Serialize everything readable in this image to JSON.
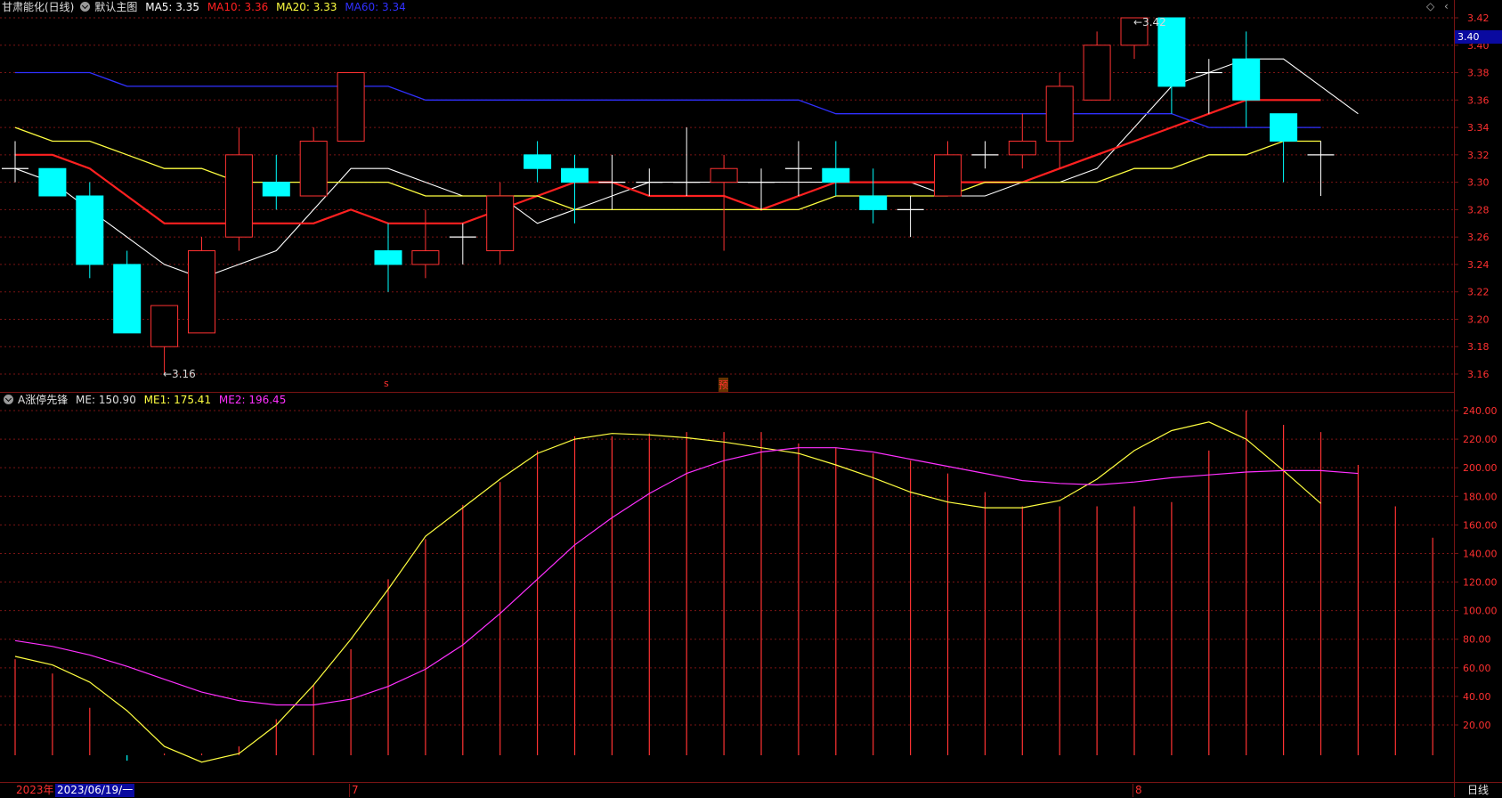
{
  "header": {
    "stock_name": "甘肃能化(日线)",
    "main_chart_label": "默认主图",
    "ma5": "MA5: 3.35",
    "ma10": "MA10: 3.36",
    "ma20": "MA20: 3.33",
    "ma60": "MA60: 3.34"
  },
  "price_axis": {
    "current_price": "3.40",
    "ticks": [
      "3.42",
      "3.40",
      "3.38",
      "3.36",
      "3.34",
      "3.32",
      "3.30",
      "3.28",
      "3.26",
      "3.24",
      "3.22",
      "3.20",
      "3.18",
      "3.16"
    ]
  },
  "indicator": {
    "title": "A涨停先锋",
    "me": "ME: 150.90",
    "me1": "ME1: 175.41",
    "me2": "ME2: 196.45",
    "ticks": [
      "240.00",
      "220.00",
      "200.00",
      "180.00",
      "160.00",
      "140.00",
      "120.00",
      "100.00",
      "80.00",
      "60.00",
      "40.00",
      "20.00"
    ]
  },
  "annotations": {
    "low_label": "←3.16",
    "high_label": "←3.42",
    "marker_s": "s",
    "marker_cn": "预"
  },
  "bottom_bar": {
    "year": "2023年",
    "date": "2023/06/19/一",
    "month_7": "7",
    "month_8": "8",
    "period": "日线"
  },
  "colors": {
    "up": "#ff3232",
    "down": "#00ffff",
    "ma5": "#ffffff",
    "ma10": "#ff2020",
    "ma20": "#ffff40",
    "ma60": "#3030ff",
    "me1": "#ffff40",
    "me2": "#ff30ff",
    "grid": "#7a1414"
  },
  "chart_data": [
    {
      "type": "candlestick",
      "title": "甘肃能化(日线)",
      "ylim": [
        3.15,
        3.43
      ],
      "candles": [
        {
          "o": 3.31,
          "h": 3.33,
          "l": 3.3,
          "c": 3.31
        },
        {
          "o": 3.31,
          "h": 3.31,
          "l": 3.29,
          "c": 3.29
        },
        {
          "o": 3.29,
          "h": 3.3,
          "l": 3.23,
          "c": 3.24
        },
        {
          "o": 3.24,
          "h": 3.25,
          "l": 3.19,
          "c": 3.19
        },
        {
          "o": 3.18,
          "h": 3.21,
          "l": 3.16,
          "c": 3.21
        },
        {
          "o": 3.19,
          "h": 3.26,
          "l": 3.19,
          "c": 3.25
        },
        {
          "o": 3.26,
          "h": 3.34,
          "l": 3.25,
          "c": 3.32
        },
        {
          "o": 3.3,
          "h": 3.32,
          "l": 3.28,
          "c": 3.29
        },
        {
          "o": 3.29,
          "h": 3.34,
          "l": 3.29,
          "c": 3.33
        },
        {
          "o": 3.33,
          "h": 3.38,
          "l": 3.33,
          "c": 3.38
        },
        {
          "o": 3.25,
          "h": 3.27,
          "l": 3.22,
          "c": 3.24
        },
        {
          "o": 3.24,
          "h": 3.28,
          "l": 3.23,
          "c": 3.25
        },
        {
          "o": 3.26,
          "h": 3.27,
          "l": 3.24,
          "c": 3.26
        },
        {
          "o": 3.25,
          "h": 3.3,
          "l": 3.24,
          "c": 3.29
        },
        {
          "o": 3.32,
          "h": 3.33,
          "l": 3.3,
          "c": 3.31
        },
        {
          "o": 3.31,
          "h": 3.32,
          "l": 3.27,
          "c": 3.3
        },
        {
          "o": 3.3,
          "h": 3.32,
          "l": 3.28,
          "c": 3.3
        },
        {
          "o": 3.3,
          "h": 3.31,
          "l": 3.29,
          "c": 3.3
        },
        {
          "o": 3.3,
          "h": 3.34,
          "l": 3.29,
          "c": 3.3
        },
        {
          "o": 3.3,
          "h": 3.32,
          "l": 3.25,
          "c": 3.31
        },
        {
          "o": 3.3,
          "h": 3.31,
          "l": 3.28,
          "c": 3.3
        },
        {
          "o": 3.31,
          "h": 3.33,
          "l": 3.29,
          "c": 3.31
        },
        {
          "o": 3.31,
          "h": 3.33,
          "l": 3.29,
          "c": 3.3
        },
        {
          "o": 3.29,
          "h": 3.31,
          "l": 3.27,
          "c": 3.28
        },
        {
          "o": 3.28,
          "h": 3.29,
          "l": 3.26,
          "c": 3.28
        },
        {
          "o": 3.29,
          "h": 3.33,
          "l": 3.29,
          "c": 3.32
        },
        {
          "o": 3.32,
          "h": 3.33,
          "l": 3.31,
          "c": 3.32
        },
        {
          "o": 3.32,
          "h": 3.35,
          "l": 3.31,
          "c": 3.33
        },
        {
          "o": 3.33,
          "h": 3.38,
          "l": 3.31,
          "c": 3.37
        },
        {
          "o": 3.36,
          "h": 3.41,
          "l": 3.36,
          "c": 3.4
        },
        {
          "o": 3.4,
          "h": 3.42,
          "l": 3.39,
          "c": 3.42
        },
        {
          "o": 3.42,
          "h": 3.42,
          "l": 3.35,
          "c": 3.37
        },
        {
          "o": 3.38,
          "h": 3.39,
          "l": 3.35,
          "c": 3.38
        },
        {
          "o": 3.39,
          "h": 3.41,
          "l": 3.34,
          "c": 3.36
        },
        {
          "o": 3.35,
          "h": 3.35,
          "l": 3.3,
          "c": 3.33
        },
        {
          "o": 3.32,
          "h": 3.33,
          "l": 3.29,
          "c": 3.32
        }
      ],
      "series": [
        {
          "name": "MA5",
          "values": [
            3.31,
            3.3,
            3.28,
            3.26,
            3.24,
            3.23,
            3.24,
            3.25,
            3.28,
            3.31,
            3.31,
            3.3,
            3.29,
            3.29,
            3.27,
            3.28,
            3.29,
            3.3,
            3.3,
            3.3,
            3.3,
            3.3,
            3.3,
            3.3,
            3.3,
            3.29,
            3.29,
            3.3,
            3.3,
            3.31,
            3.34,
            3.37,
            3.38,
            3.39,
            3.39,
            3.37,
            3.35
          ]
        },
        {
          "name": "MA10",
          "values": [
            3.32,
            3.32,
            3.31,
            3.29,
            3.27,
            3.27,
            3.27,
            3.27,
            3.27,
            3.28,
            3.27,
            3.27,
            3.27,
            3.28,
            3.29,
            3.3,
            3.3,
            3.29,
            3.29,
            3.29,
            3.28,
            3.29,
            3.3,
            3.3,
            3.3,
            3.3,
            3.3,
            3.3,
            3.31,
            3.32,
            3.33,
            3.34,
            3.35,
            3.36,
            3.36,
            3.36
          ]
        },
        {
          "name": "MA20",
          "values": [
            3.34,
            3.33,
            3.33,
            3.32,
            3.31,
            3.31,
            3.3,
            3.3,
            3.3,
            3.3,
            3.3,
            3.29,
            3.29,
            3.29,
            3.29,
            3.28,
            3.28,
            3.28,
            3.28,
            3.28,
            3.28,
            3.28,
            3.29,
            3.29,
            3.29,
            3.29,
            3.3,
            3.3,
            3.3,
            3.3,
            3.31,
            3.31,
            3.32,
            3.32,
            3.33,
            3.33
          ]
        },
        {
          "name": "MA60",
          "values": [
            3.38,
            3.38,
            3.38,
            3.37,
            3.37,
            3.37,
            3.37,
            3.37,
            3.37,
            3.37,
            3.37,
            3.36,
            3.36,
            3.36,
            3.36,
            3.36,
            3.36,
            3.36,
            3.36,
            3.36,
            3.36,
            3.36,
            3.35,
            3.35,
            3.35,
            3.35,
            3.35,
            3.35,
            3.35,
            3.35,
            3.35,
            3.35,
            3.34,
            3.34,
            3.34,
            3.34
          ]
        }
      ]
    },
    {
      "type": "bar+line",
      "title": "A涨停先锋",
      "ylim": [
        0,
        250
      ],
      "series": [
        {
          "name": "ME",
          "values": [
            66,
            56,
            32,
            -5,
            0,
            0,
            5,
            24,
            48,
            73,
            122,
            150,
            174,
            190,
            212,
            222,
            222,
            224,
            225,
            225,
            225,
            217,
            214,
            210,
            205,
            196,
            183,
            173,
            173,
            173,
            173,
            176,
            212,
            240,
            230,
            225,
            202,
            173,
            151
          ]
        },
        {
          "name": "ME1",
          "values": [
            68,
            62,
            50,
            30,
            5,
            -6,
            0,
            20,
            48,
            80,
            115,
            152,
            172,
            192,
            210,
            220,
            224,
            223,
            221,
            218,
            214,
            210,
            202,
            193,
            183,
            176,
            172,
            172,
            177,
            192,
            212,
            226,
            232,
            220,
            198,
            175
          ]
        },
        {
          "name": "ME2",
          "values": [
            79,
            75,
            69,
            61,
            52,
            43,
            37,
            34,
            34,
            38,
            47,
            59,
            76,
            98,
            122,
            146,
            165,
            182,
            196,
            205,
            211,
            214,
            214,
            211,
            206,
            201,
            196,
            191,
            189,
            188,
            190,
            193,
            195,
            197,
            198,
            198,
            196
          ]
        }
      ]
    }
  ]
}
